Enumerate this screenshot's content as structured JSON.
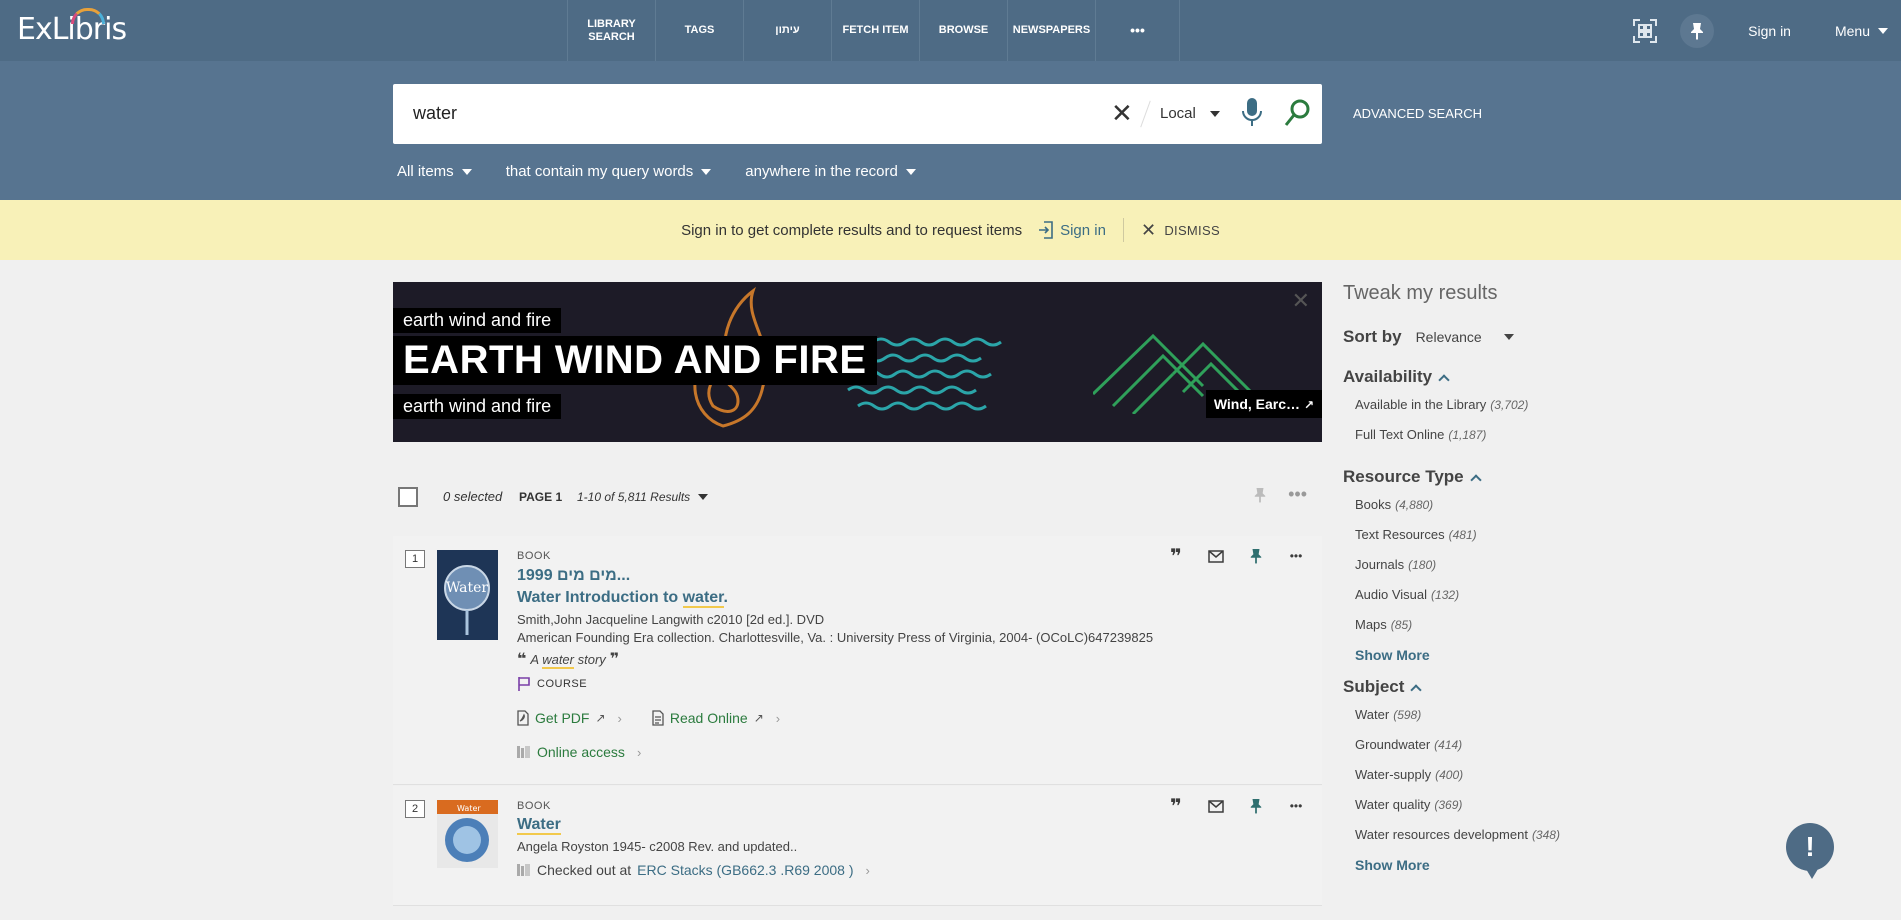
{
  "brand": {
    "logo": "ExLibris"
  },
  "nav": {
    "items": [
      {
        "label": "LIBRARY SEARCH",
        "width": 88
      },
      {
        "label": "TAGS",
        "width": 88
      },
      {
        "label": "עיתון",
        "width": 88
      },
      {
        "label": "FETCH ITEM",
        "width": 88
      },
      {
        "label": "BROWSE",
        "width": 88
      },
      {
        "label": "NEWSPAPERS",
        "width": 88
      },
      {
        "label": "•••",
        "width": 84
      }
    ],
    "signin": "Sign in",
    "menu": "Menu"
  },
  "search": {
    "query": "water",
    "scope": "Local",
    "advanced": "ADVANCED SEARCH",
    "filters": {
      "type": "All items",
      "match": "that contain my query words",
      "field": "anywhere in the record"
    }
  },
  "signin_banner": {
    "message": "Sign in to get complete results and to request items",
    "link": "Sign in",
    "dismiss": "DISMISS"
  },
  "promo": {
    "top_label": "earth wind and fire",
    "big_label": "EARTH WIND AND FIRE",
    "bottom_label": "earth wind and fire",
    "link": "Wind, Earc…",
    "close": "✕"
  },
  "results_header": {
    "selected": "0 selected",
    "page": "PAGE 1",
    "count": "1-10 of 5,811 Results"
  },
  "results": [
    {
      "num": "1",
      "type": "BOOK",
      "title_he": "1999 מים מים...",
      "title_pre": "Water Introduction to ",
      "title_hl": "water",
      "title_post": ".",
      "authors": "Smith,John Jacqueline Langwith c2010 [2d ed.]. DVD",
      "publication": "American Founding Era collection. Charlottesville, Va. : University Press of Virginia, 2004- (OCoLC)647239825",
      "quote_pre": "A ",
      "quote_hl": "water",
      "quote_post": " story",
      "course": "COURSE",
      "links": {
        "pdf": "Get PDF",
        "read": "Read Online",
        "online": "Online access"
      }
    },
    {
      "num": "2",
      "type": "BOOK",
      "title": "Water",
      "authors": "Angela Royston 1945- c2008 Rev. and updated..",
      "checked_out": "Checked out at",
      "location": "ERC  Stacks (GB662.3 .R69 2008 )"
    }
  ],
  "sidebar": {
    "title": "Tweak my results",
    "sort_label": "Sort by",
    "sort_value": "Relevance",
    "availability": {
      "heading": "Availability",
      "items": [
        {
          "label": "Available in the Library",
          "count": "(3,702)"
        },
        {
          "label": "Full Text Online",
          "count": "(1,187)"
        }
      ]
    },
    "resource_type": {
      "heading": "Resource Type",
      "items": [
        {
          "label": "Books",
          "count": "(4,880)"
        },
        {
          "label": "Text Resources",
          "count": "(481)"
        },
        {
          "label": "Journals",
          "count": "(180)"
        },
        {
          "label": "Audio Visual",
          "count": "(132)"
        },
        {
          "label": "Maps",
          "count": "(85)"
        }
      ],
      "show_more": "Show More"
    },
    "subject": {
      "heading": "Subject",
      "items": [
        {
          "label": "Water",
          "count": "(598)"
        },
        {
          "label": "Groundwater",
          "count": "(414)"
        },
        {
          "label": "Water-supply",
          "count": "(400)"
        },
        {
          "label": "Water quality",
          "count": "(369)"
        },
        {
          "label": "Water resources development",
          "count": "(348)"
        }
      ],
      "show_more": "Show More"
    }
  },
  "feedback": {
    "symbol": "!"
  },
  "colors": {
    "header": "#4e6b85",
    "search_band": "#577490",
    "banner": "#f8f1b8",
    "link": "#3c6d84",
    "green": "#2b7b3e"
  }
}
